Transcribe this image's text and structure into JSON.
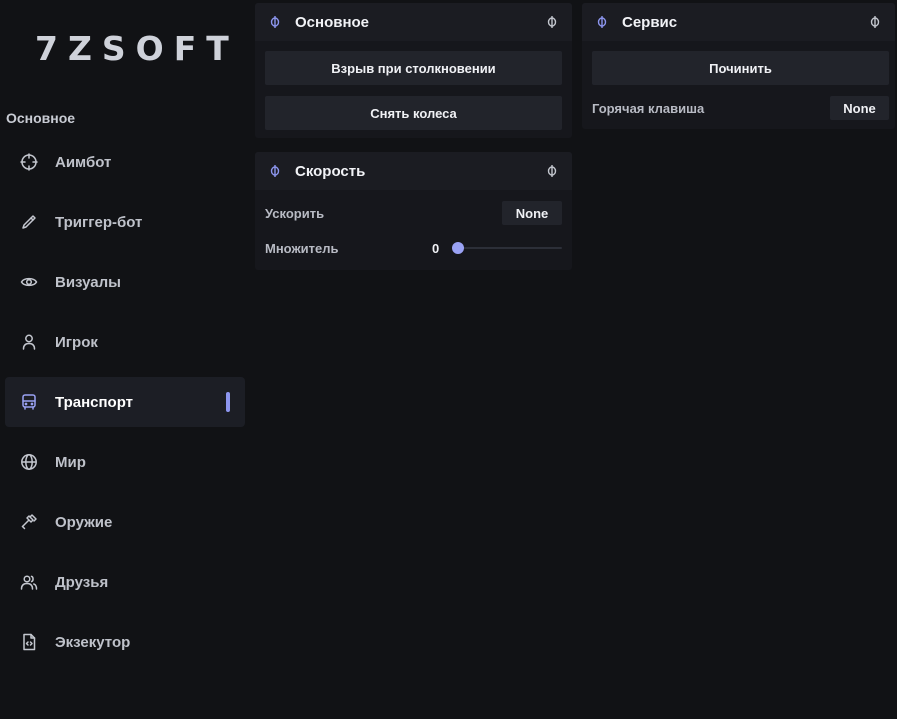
{
  "app": {
    "logo": "7ZSOFT",
    "accent_color": "#8d96ef"
  },
  "sidebar": {
    "section_label": "Основное",
    "items": [
      {
        "label": "Аимбот",
        "icon": "crosshair-icon"
      },
      {
        "label": "Триггер-бот",
        "icon": "pen-icon"
      },
      {
        "label": "Визуалы",
        "icon": "eye-icon"
      },
      {
        "label": "Игрок",
        "icon": "user-icon"
      },
      {
        "label": "Транспорт",
        "icon": "bus-icon",
        "active": true
      },
      {
        "label": "Мир",
        "icon": "globe-icon"
      },
      {
        "label": "Оружие",
        "icon": "hammer-icon"
      },
      {
        "label": "Друзья",
        "icon": "users-icon"
      },
      {
        "label": "Экзекутор",
        "icon": "file-code-icon"
      }
    ]
  },
  "panels": {
    "main": {
      "title": "Основное",
      "buttons": [
        "Взрыв при столкновении",
        "Снять колеса"
      ]
    },
    "speed": {
      "title": "Скорость",
      "accelerate_label": "Ускорить",
      "accelerate_key": "None",
      "multiplier_label": "Множитель",
      "multiplier_value": "0",
      "multiplier_fraction": 0
    },
    "service": {
      "title": "Сервис",
      "repair_button": "Починить",
      "hotkey_label": "Горячая клавиша",
      "hotkey_value": "None"
    }
  }
}
